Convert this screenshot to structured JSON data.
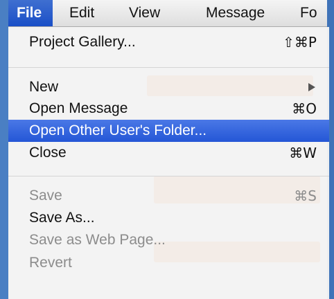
{
  "menubar": {
    "items": [
      "File",
      "Edit",
      "View",
      "Message",
      "Fo"
    ],
    "active_index": 0
  },
  "file_menu": {
    "items": [
      {
        "label": "Project Gallery...",
        "shortcut": "⇧⌘P",
        "state": "enabled"
      },
      {
        "label": "New",
        "submenu": true,
        "state": "enabled"
      },
      {
        "label": "Open Message",
        "shortcut": "⌘O",
        "state": "enabled"
      },
      {
        "label": "Open Other User's Folder...",
        "shortcut": "",
        "state": "highlighted"
      },
      {
        "label": "Close",
        "shortcut": "⌘W",
        "state": "enabled"
      },
      {
        "label": "Save",
        "shortcut": "⌘S",
        "state": "disabled"
      },
      {
        "label": "Save As...",
        "shortcut": "",
        "state": "enabled"
      },
      {
        "label": "Save as Web Page...",
        "shortcut": "",
        "state": "disabled"
      },
      {
        "label": "Revert",
        "shortcut": "",
        "state": "disabled"
      }
    ]
  },
  "colors": {
    "highlight": "#2456d6",
    "window_border": "#4a7fc3",
    "disabled_text": "#8c8c8c"
  }
}
